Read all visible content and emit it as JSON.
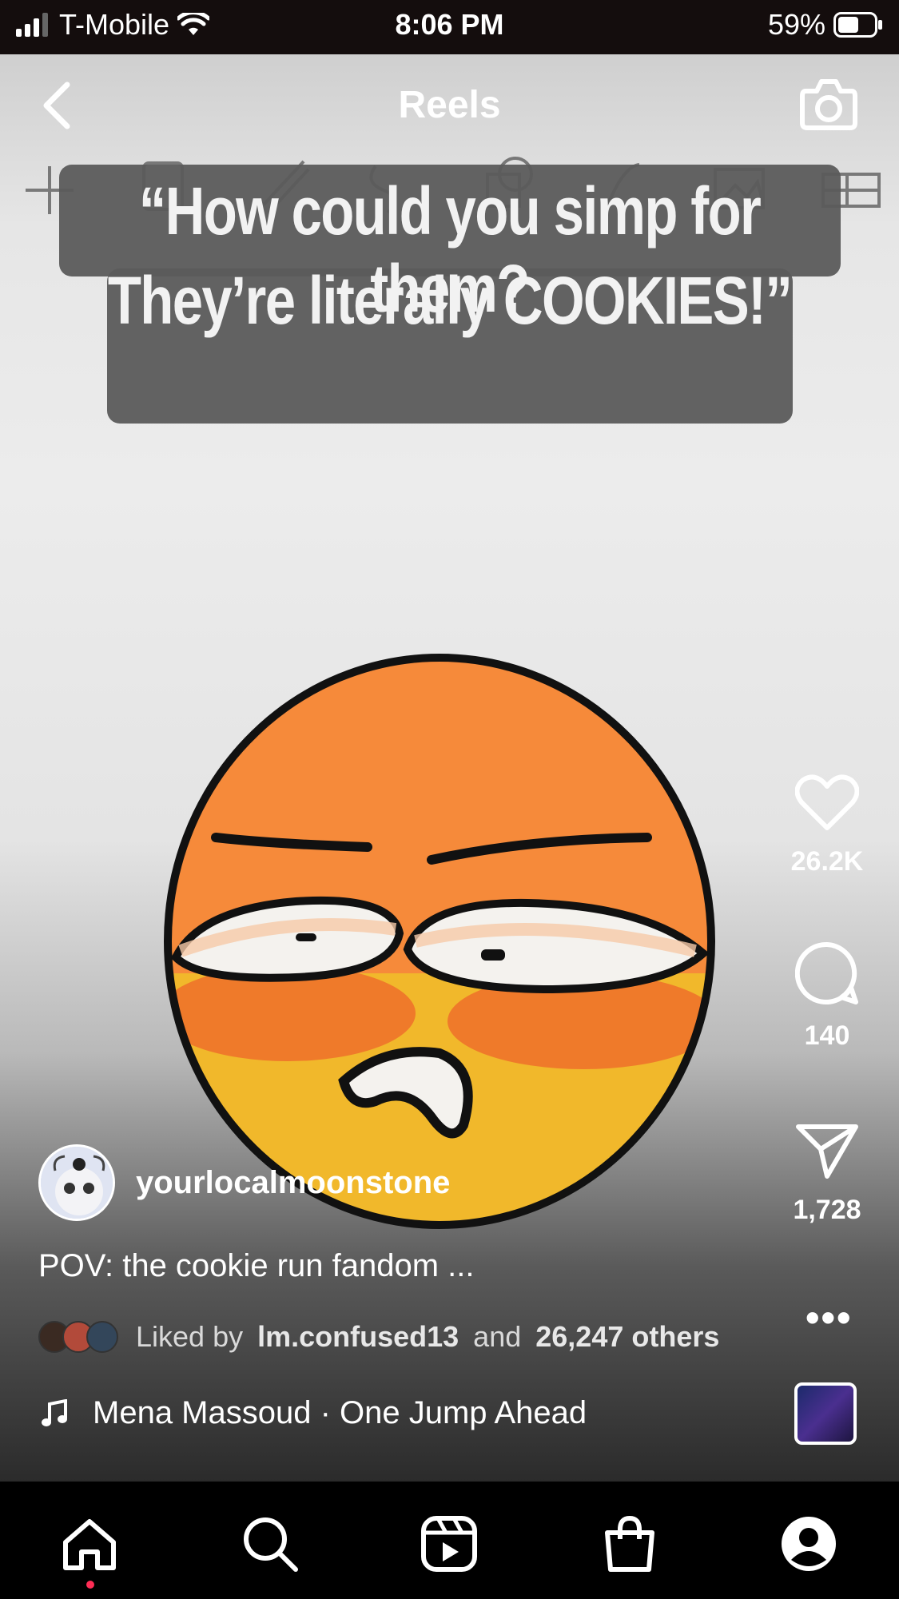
{
  "status_bar": {
    "carrier": "T-Mobile",
    "time": "8:06 PM",
    "battery": "59%",
    "battery_level": 0.59
  },
  "header": {
    "title": "Reels"
  },
  "video": {
    "caption_line1": "“How could you simp for them?",
    "caption_line2": "They’re literally COOKIES!”"
  },
  "actions": {
    "likes": "26.2K",
    "comments": "140",
    "shares": "1,728"
  },
  "post": {
    "username": "yourlocalmoonstone",
    "caption": "POV: the cookie run fandom ...",
    "liked_prefix": "Liked by",
    "liked_user": "lm.confused13",
    "liked_and": "and",
    "liked_others": "26,247 others"
  },
  "audio": {
    "track": "Mena Massoud · One Jump Ahead"
  },
  "nav": {
    "items": [
      "home-icon",
      "search-icon",
      "reels-icon",
      "shop-icon",
      "profile-icon"
    ]
  },
  "colors": {
    "notification_dot": "#ff2d55",
    "face_orange": "#f68a3a",
    "face_yellow": "#f1b82b"
  }
}
